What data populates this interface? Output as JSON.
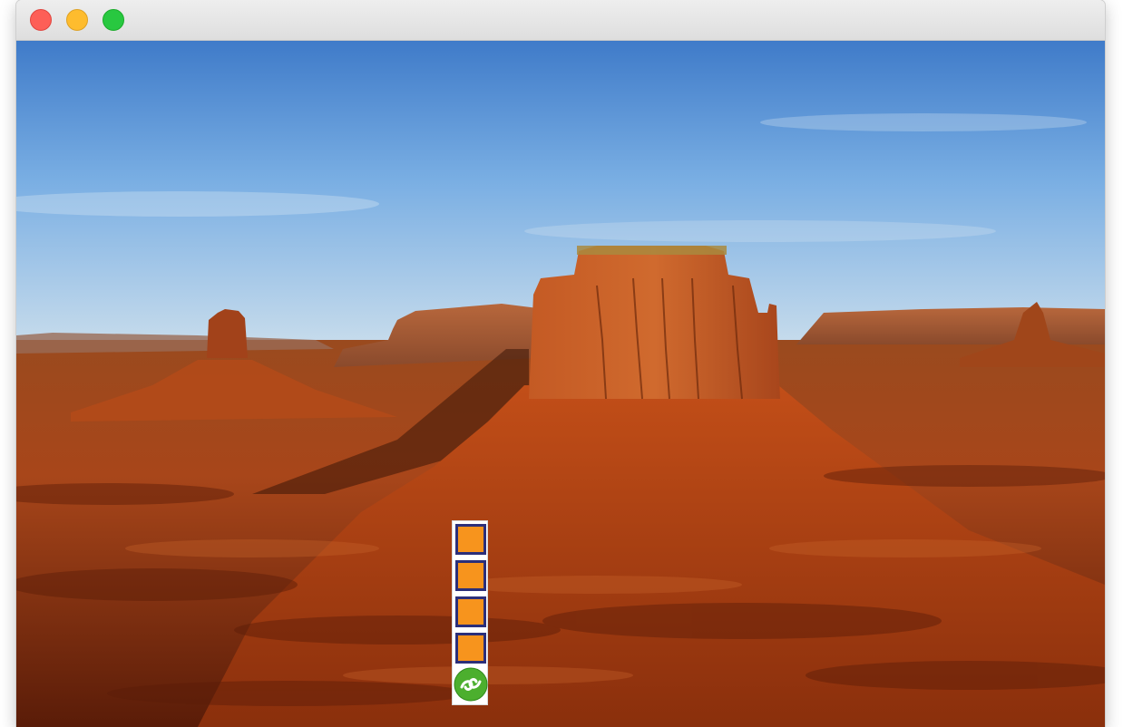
{
  "window": {
    "buttons": [
      "close",
      "minimize",
      "zoom"
    ]
  },
  "wallpaper": {
    "description_icon": "desert-mesa-landscape-icon"
  },
  "toolstrip": {
    "buttons": [
      {
        "icon": "orange-square-icon",
        "color": "#f7941d"
      },
      {
        "icon": "orange-square-icon",
        "color": "#f7941d"
      },
      {
        "icon": "orange-square-icon",
        "color": "#f7941d"
      },
      {
        "icon": "orange-square-icon",
        "color": "#f7941d"
      }
    ],
    "logo": {
      "icon": "green-swirl-logo-icon",
      "color": "#4caf2e"
    }
  },
  "colors": {
    "close": "#fd5f57",
    "minimize": "#febc2e",
    "zoom": "#28c840",
    "button_fill": "#f7941d",
    "button_border": "#2b2f7a"
  }
}
